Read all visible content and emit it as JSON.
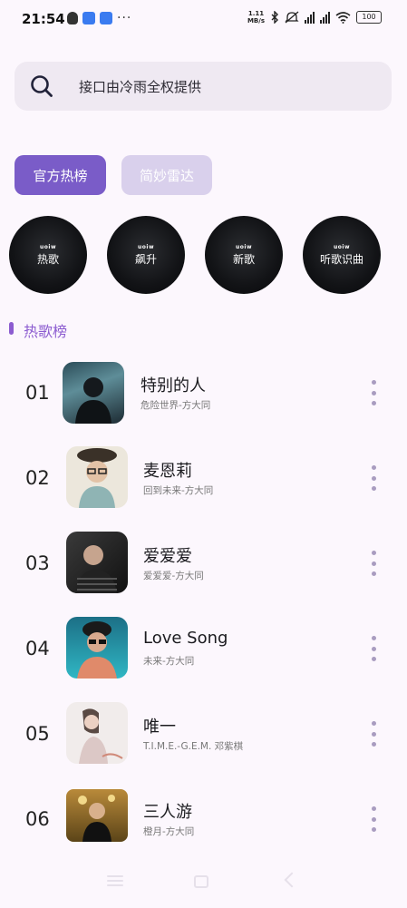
{
  "status_bar": {
    "time": "21:54",
    "net_speed_value": "1.11",
    "net_speed_unit": "MB/s",
    "battery": "100",
    "more": "···"
  },
  "search": {
    "text": "接口由冷雨全权提供",
    "icon": "search-icon"
  },
  "tabs": [
    {
      "label": "官方热榜",
      "active": true
    },
    {
      "label": "简妙雷达",
      "active": false
    }
  ],
  "charts": [
    {
      "brand": "uoiw",
      "label": "热歌"
    },
    {
      "brand": "uoiw",
      "label": "飙升"
    },
    {
      "brand": "uoiw",
      "label": "新歌"
    },
    {
      "brand": "uoiw",
      "label": "听歌识曲"
    }
  ],
  "section": {
    "title": "热歌榜"
  },
  "songs": [
    {
      "rank": "01",
      "title": "特别的人",
      "subtitle": "危险世界-方大同"
    },
    {
      "rank": "02",
      "title": "麦恩莉",
      "subtitle": "回到未来-方大同"
    },
    {
      "rank": "03",
      "title": "爱爱爱",
      "subtitle": "爱爱爱-方大同"
    },
    {
      "rank": "04",
      "title": "Love Song",
      "subtitle": "未来-方大同"
    },
    {
      "rank": "05",
      "title": "唯一",
      "subtitle": "T.I.M.E.-G.E.M. 邓紫棋"
    },
    {
      "rank": "06",
      "title": "三人游",
      "subtitle": "橙月-方大同"
    }
  ],
  "colors": {
    "accent": "#7a5cc8",
    "accent_light": "#d9d0ec",
    "section": "#8c5cd0",
    "background": "#fcf7fd"
  }
}
